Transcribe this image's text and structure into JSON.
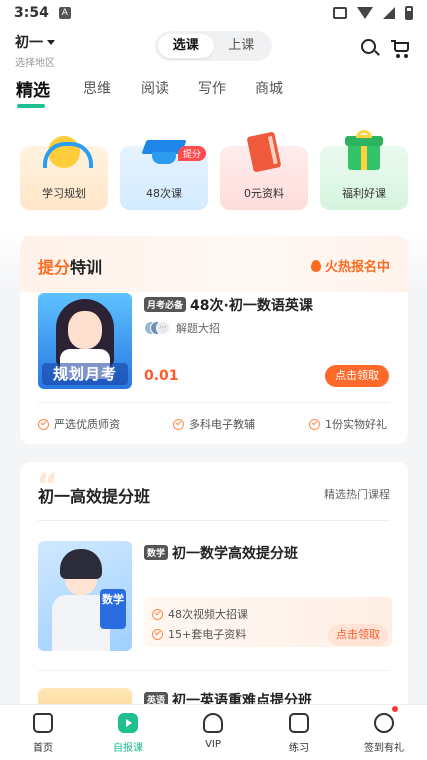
{
  "status_bar": {
    "time": "3:54"
  },
  "header": {
    "grade": "初一",
    "grade_sub": "选择地区",
    "segments": [
      "选课",
      "上课"
    ]
  },
  "tabs": [
    "精选",
    "思维",
    "阅读",
    "写作",
    "商城"
  ],
  "quick_entries": [
    {
      "label": "学习规划",
      "icon": "headphone-smile-icon"
    },
    {
      "label": "48次课",
      "icon": "graduation-cap-icon",
      "badge": "提分"
    },
    {
      "label": "0元资料",
      "icon": "book-icon"
    },
    {
      "label": "福利好课",
      "icon": "gift-box-icon"
    }
  ],
  "promo": {
    "title_highlight": "提分",
    "title_rest": "特训",
    "hot_label": "火热报名中",
    "image_caption": "规划月考",
    "course_tag": "月考必备",
    "course_title": "48次·初一数语英课",
    "teacher_note": "解题大招",
    "price": "0.01",
    "button": "点击领取",
    "features": [
      "严选优质师资",
      "多科电子教辅",
      "1份实物好礼"
    ]
  },
  "section2": {
    "title": "初一高效提分班",
    "more": "精选热门课程",
    "course1": {
      "tag": "数学",
      "title": "初一数学高效提分班",
      "image_subject": "数学",
      "features": [
        "48次视频大招课",
        "15+套电子资料"
      ],
      "button": "点击领取"
    },
    "course2": {
      "tag": "英语",
      "title": "初一英语重难点提分班"
    }
  },
  "bottom_nav": [
    {
      "label": "首页",
      "icon": "home-icon"
    },
    {
      "label": "自报课",
      "icon": "play-icon"
    },
    {
      "label": "VIP",
      "icon": "vip-icon"
    },
    {
      "label": "练习",
      "icon": "practice-icon"
    },
    {
      "label": "签到有礼",
      "icon": "sign-in-gift-icon"
    }
  ],
  "colors": {
    "accent": "#1fbf8f",
    "orange": "#ff6a2b"
  }
}
